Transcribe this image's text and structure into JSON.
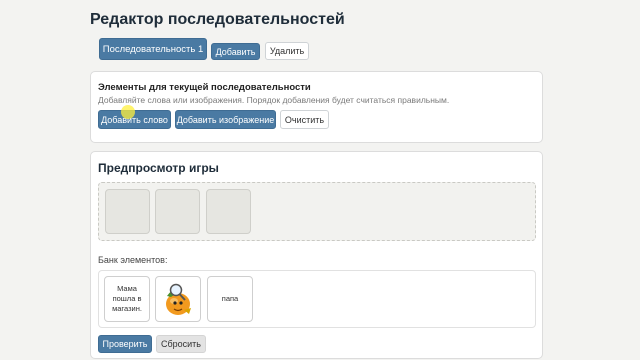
{
  "header": {
    "title": "Редактор последовательностей"
  },
  "tabs": {
    "active_label": "Последовательность 1",
    "add_label": "Добавить",
    "delete_label": "Удалить"
  },
  "elements_card": {
    "title": "Элементы для текущей последовательности",
    "hint": "Добавляйте слова или изображения. Порядок добавления будет считаться правильным.",
    "add_word_label": "Добавить слово",
    "add_image_label": "Добавить изображение",
    "clear_label": "Очистить"
  },
  "preview": {
    "title": "Предпросмотр игры",
    "bank_label": "Банк элементов:",
    "bank_items": [
      {
        "type": "text",
        "text": "Мама пошла в магазин."
      },
      {
        "type": "image",
        "icon": "cartoon-orange-with-magnifier-icon"
      },
      {
        "type": "text",
        "text": "папа"
      }
    ],
    "check_label": "Проверить",
    "reset_label": "Сбросить"
  },
  "colors": {
    "primary": "#4a7aa3",
    "background": "#f3f3f1"
  }
}
